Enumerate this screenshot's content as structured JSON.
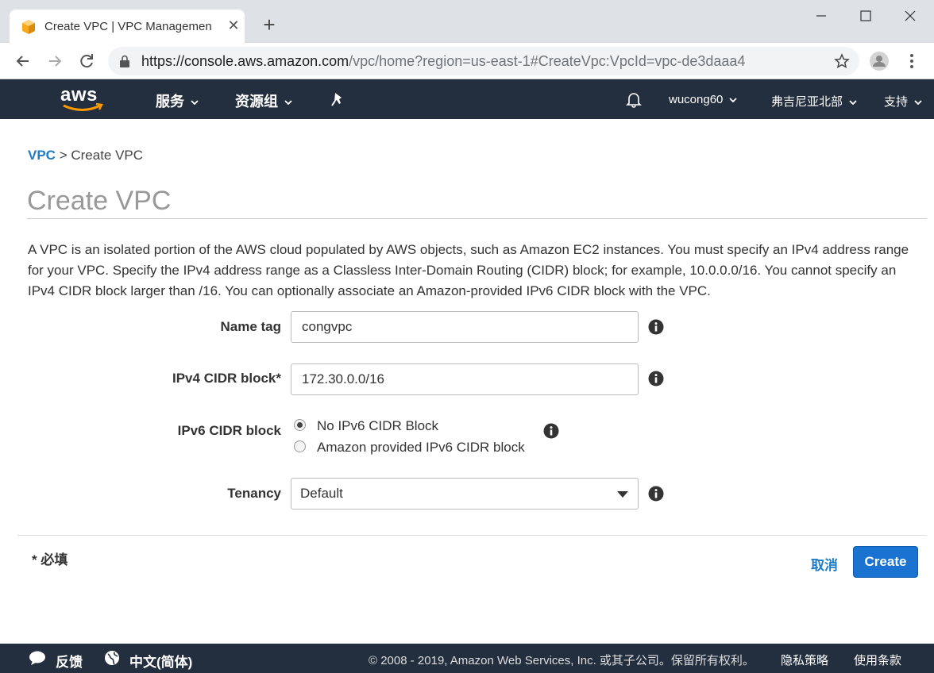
{
  "browser": {
    "tab_title": "Create VPC | VPC Managemen",
    "url_host": "https://console.aws.amazon.com",
    "url_path": "/vpc/home?region=us-east-1#CreateVpc:VpcId=vpc-de3daaa4"
  },
  "aws_nav": {
    "logo": "aws",
    "services": "服务",
    "resource_groups": "资源组",
    "user": "wucong60",
    "region": "弗吉尼亚北部",
    "support": "支持"
  },
  "breadcrumb": {
    "root": "VPC",
    "separator": " > ",
    "current": "Create VPC"
  },
  "page": {
    "title": "Create VPC",
    "description": "A VPC is an isolated portion of the AWS cloud populated by AWS objects, such as Amazon EC2 instances. You must specify an IPv4 address range for your VPC. Specify the IPv4 address range as a Classless Inter-Domain Routing (CIDR) block; for example, 10.0.0.0/16. You cannot specify an IPv4 CIDR block larger than /16. You can optionally associate an Amazon-provided IPv6 CIDR block with the VPC."
  },
  "form": {
    "name_tag_label": "Name tag",
    "name_tag_value": "congvpc",
    "ipv4_label": "IPv4 CIDR block*",
    "ipv4_value": "172.30.0.0/16",
    "ipv6_label": "IPv6 CIDR block",
    "ipv6_options": [
      "No IPv6 CIDR Block",
      "Amazon provided IPv6 CIDR block"
    ],
    "ipv6_selected": "No IPv6 CIDR Block",
    "tenancy_label": "Tenancy",
    "tenancy_value": "Default"
  },
  "actions": {
    "required_note": "* 必填",
    "cancel": "取消",
    "create": "Create"
  },
  "footer": {
    "feedback": "反馈",
    "language": "中文(简体)",
    "copyright": "© 2008 - 2019, Amazon Web Services, Inc. 或其子公司。保留所有权利。",
    "privacy": "隐私策略",
    "terms": "使用条款"
  },
  "colors": {
    "nav_bg": "#232f3e",
    "link": "#1f7cc6",
    "primary_button": "#1a73d0",
    "aws_orange": "#ff9900"
  }
}
